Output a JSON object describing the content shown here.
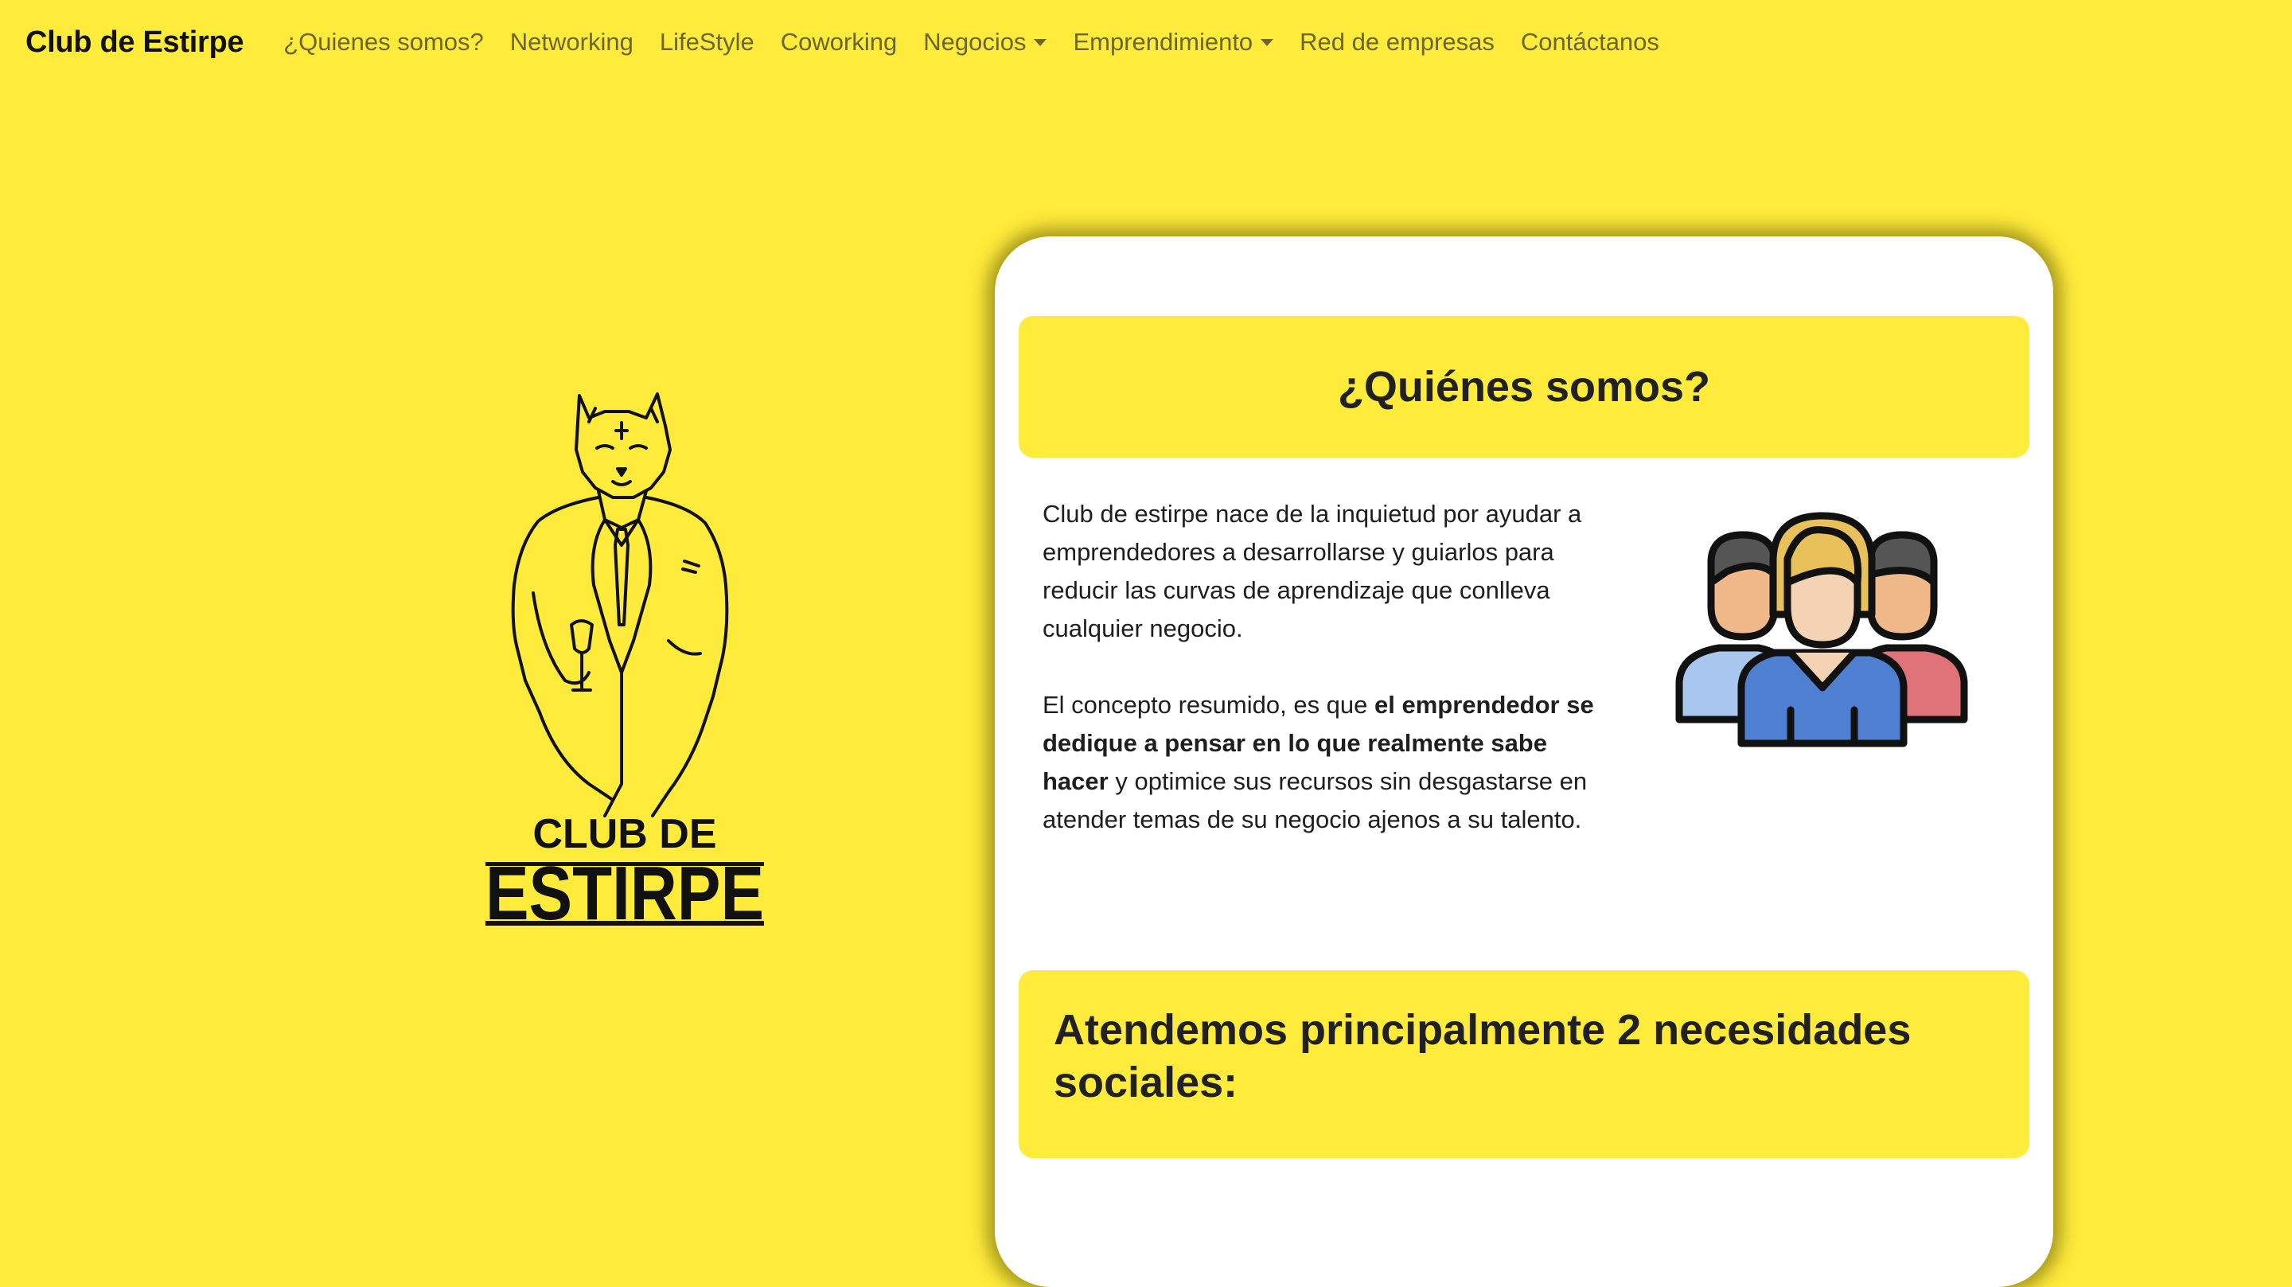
{
  "navbar": {
    "brand": "Club de Estirpe",
    "items": [
      {
        "label": "¿Quienes somos?",
        "dropdown": false
      },
      {
        "label": "Networking",
        "dropdown": false
      },
      {
        "label": "LifeStyle",
        "dropdown": false
      },
      {
        "label": "Coworking",
        "dropdown": false
      },
      {
        "label": "Negocios",
        "dropdown": true
      },
      {
        "label": "Emprendimiento",
        "dropdown": true
      },
      {
        "label": "Red de empresas",
        "dropdown": false
      },
      {
        "label": "Contáctanos",
        "dropdown": false
      }
    ]
  },
  "logo": {
    "line1": "CLUB DE",
    "line2": "ESTIRPE",
    "icon": "panther-in-suit-with-wine-glass"
  },
  "about": {
    "title": "¿Quiénes somos?",
    "paragraph1": "Club de estirpe nace de la inquietud por ayudar a emprendedores a desarrollarse y guiarlos para reducir las curvas de aprendizaje que conlleva cualquier negocio.",
    "paragraph2_start": "El concepto resumido, es que ",
    "paragraph2_bold": "el emprendedor se dedique a pensar en lo que realmente sabe hacer",
    "paragraph2_end": " y optimice sus recursos sin desgastarse en atender temas de su negocio ajenos a su talento.",
    "illustration": "team-people-icon"
  },
  "needs": {
    "title": "Atendemos principalmente 2 necesidades sociales:"
  },
  "colors": {
    "background": "#ffeb3b",
    "card": "#ffffff",
    "nav_text": "#6b6630"
  }
}
